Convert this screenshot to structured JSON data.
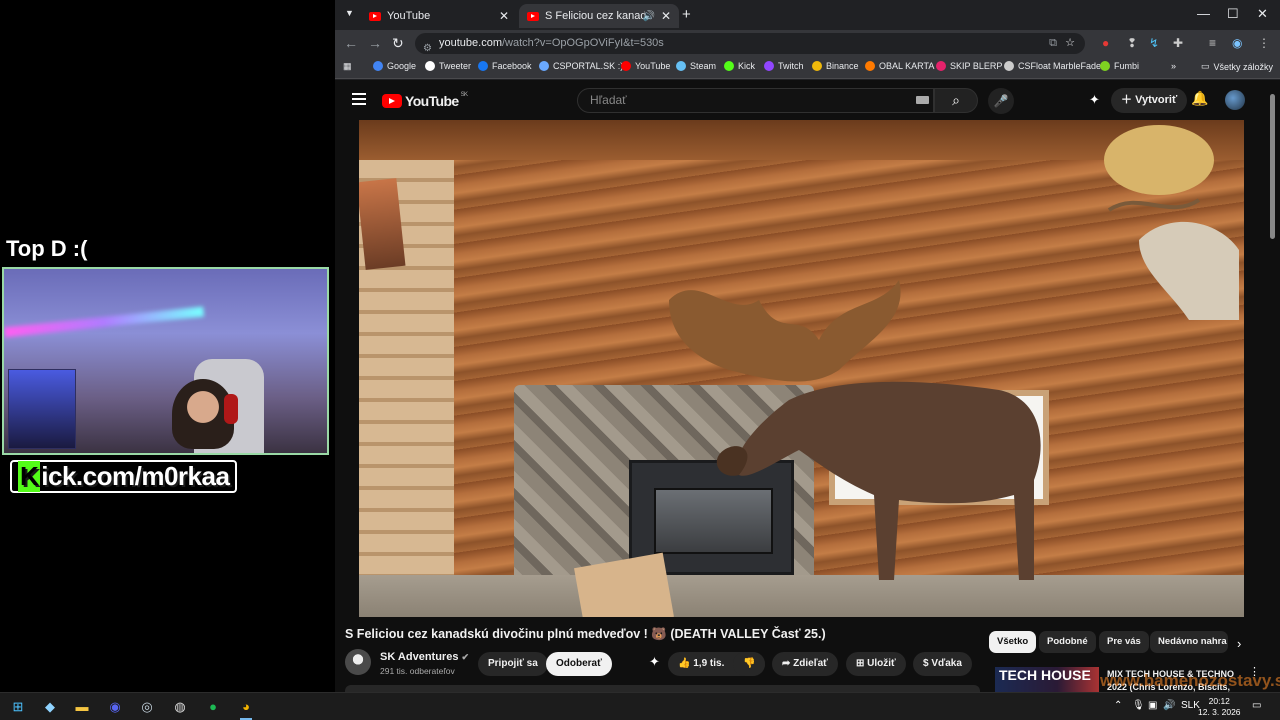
{
  "overlay": {
    "title": "Top D :(",
    "kick_letter": "K",
    "kick_rest": "ick.com/m0rkaa"
  },
  "browser": {
    "tabs": [
      {
        "label": "YouTube",
        "active": false
      },
      {
        "label": "S Feliciou cez kanadskú div",
        "active": true
      }
    ],
    "new_tab": "+",
    "url_host": "youtube.com",
    "url_path": "/watch?v=OpOGpOViFyI&t=530s",
    "bookmarks": [
      {
        "label": "Google",
        "color": "#4285f4"
      },
      {
        "label": "Tweeter",
        "color": "#ffffff"
      },
      {
        "label": "Facebook",
        "color": "#1877f2"
      },
      {
        "label": "CSPORTAL.SK :)",
        "color": "#6aa9ff"
      },
      {
        "label": "YouTube",
        "color": "#ff0000"
      },
      {
        "label": "Steam",
        "color": "#66c0f4"
      },
      {
        "label": "Kick",
        "color": "#53fc18"
      },
      {
        "label": "Twitch",
        "color": "#9146ff"
      },
      {
        "label": "Binance",
        "color": "#f0b90b"
      },
      {
        "label": "OBAL KARTA",
        "color": "#ff7a00"
      },
      {
        "label": "SKIP BLERP",
        "color": "#e5226b"
      },
      {
        "label": "CSFloat MarbleFade",
        "color": "#cccccc"
      },
      {
        "label": "Fumbi",
        "color": "#7ed321"
      }
    ],
    "all_bookmarks": "Všetky záložky"
  },
  "youtube": {
    "logo_text": "YouTube",
    "logo_region": "SK",
    "search_placeholder": "Hľadať",
    "create_label": "Vytvoriť",
    "video_title": "S Feliciou cez kanadskú divočinu plnú medveďov ! 🐻 (DEATH VALLEY Časť 25.)",
    "channel_name": "SK Adventures",
    "subscribers": "291 tis. odberateľov",
    "join_label": "Pripojiť sa",
    "subscribe_label": "Odoberať",
    "likes": "1,9 tis.",
    "share_label": "Zdieľať",
    "save_label": "Uložiť",
    "thanks_label": "Vďaka",
    "chips": [
      "Všetko",
      "Podobné",
      "Pre vás",
      "Nedávno nahra"
    ],
    "suggested_thumb_text": "TECH HOUSE",
    "suggested_title": "MIX TECH HOUSE & TECHNO",
    "suggested_subtitle": "2022 (Chris Lorenzo, Biscits,",
    "watermark": "www.bamenozostavy.sk"
  },
  "taskbar": {
    "language": "SLK",
    "time": "20:12",
    "date": "12. 3. 2026"
  }
}
